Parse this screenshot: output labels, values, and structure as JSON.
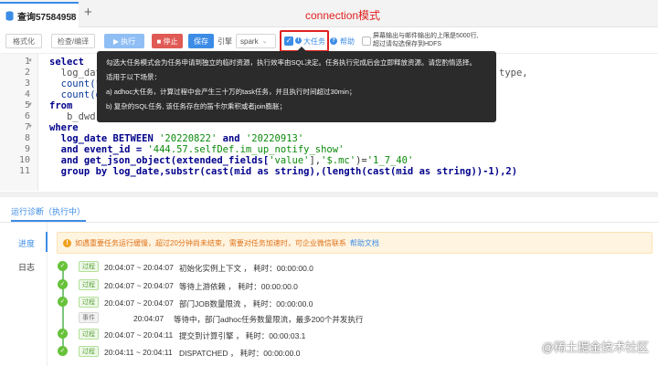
{
  "tab": {
    "title": "查询57584958",
    "close": "×",
    "add": "+"
  },
  "annotation": {
    "connection_label": "connection模式"
  },
  "toolbar": {
    "format_label": "格式化",
    "check_label": "检查/编译",
    "run_label": "▶ 执行",
    "stop_label": "■ 停止",
    "save_label": "保存",
    "engine_label": "引擎",
    "engine_value": "spark",
    "bigtask_label": "大任务",
    "bigtask_checked": true,
    "help_label": "帮助",
    "hdfs_label": "屏幕输出与邮件输出的上限是5000行,超过请勾选保存到HDFS",
    "hdfs_checked": false
  },
  "editor": {
    "line_numbers": [
      "1",
      "2",
      "3",
      "4",
      "5",
      "6",
      "7",
      "8",
      "9",
      "10",
      "11"
    ],
    "line1": "select",
    "line2a": "  log_date",
    "line2b": "type,",
    "line3": "  count(*)",
    "line4": "  count(di",
    "line5": "from",
    "line6": "   b_dwd.c",
    "line7": "where",
    "line8_kw": "  log_date BETWEEN ",
    "line8_s1": "'20220822'",
    "line8_and": " and ",
    "line8_s2": "'20220913'",
    "line9_a": "  and event_id = ",
    "line9_s": "'444.57.selfDef.im_up_notify_show'",
    "line10_a": "  and get_json_object(extended_fields[",
    "line10_s1": "'value'",
    "line10_b": "],",
    "line10_s2": "'$.mc'",
    "line10_c": ")=",
    "line10_s3": "'1_7_40'",
    "line11": "  group by log_date,substr(cast(mid as string),(length(cast(mid as string))-1),2)"
  },
  "tooltip": {
    "p1": "勾选大任务模式会为任务申请到独立的临时资源，执行效率由SQL决定。任务执行完成后会立即释放资源。请您酌情选择。",
    "p2": "适用于以下场景：",
    "p3": "a) adhoc大任务，计算过程中会产生三十万的task任务，并且执行时间超过30min；",
    "p4": "b) 复杂的SQL任务, 该任务存在的笛卡尔乘积或者join膨胀；"
  },
  "panel": {
    "tab_label": "运行诊断（执行中）",
    "side_progress": "进度",
    "side_log": "日志",
    "notice": "如遇重要任务运行缓慢，超过20分钟尚未结束，需要对任务加速时，可企业微信联系",
    "notice_link": "帮助文档"
  },
  "logs": [
    {
      "tag": "过程",
      "time": "20:04:07 ~ 20:04:07",
      "text": "初始化实例上下文 ， 耗时：00:00:00.0"
    },
    {
      "tag": "过程",
      "time": "20:04:07 ~ 20:04:07",
      "text": "等待上游依赖 ， 耗时：00:00:00.0"
    },
    {
      "tag": "过程",
      "time": "20:04:07 ~ 20:04:07",
      "text": "部门JOB数量限流 ， 耗时：00:00:00.0"
    },
    {
      "tag": "事件",
      "time": "20:04:07",
      "text": "等待中，部门adhoc任务数量限流，最多200个并发执行"
    },
    {
      "tag": "过程",
      "time": "20:04:07 ~ 20:04:11",
      "text": "提交到计算引擎 ， 耗时：00:00:03.1"
    },
    {
      "tag": "过程",
      "time": "20:04:11 ~ 20:04:11",
      "text": "DISPATCHED ， 耗时：00:00:00.0"
    }
  ],
  "watermark": "@稀土掘金技术社区",
  "colors": {
    "accent": "#3c8ce6",
    "danger": "#e05a55",
    "success": "#67c23a",
    "annotation": "#e02020"
  }
}
